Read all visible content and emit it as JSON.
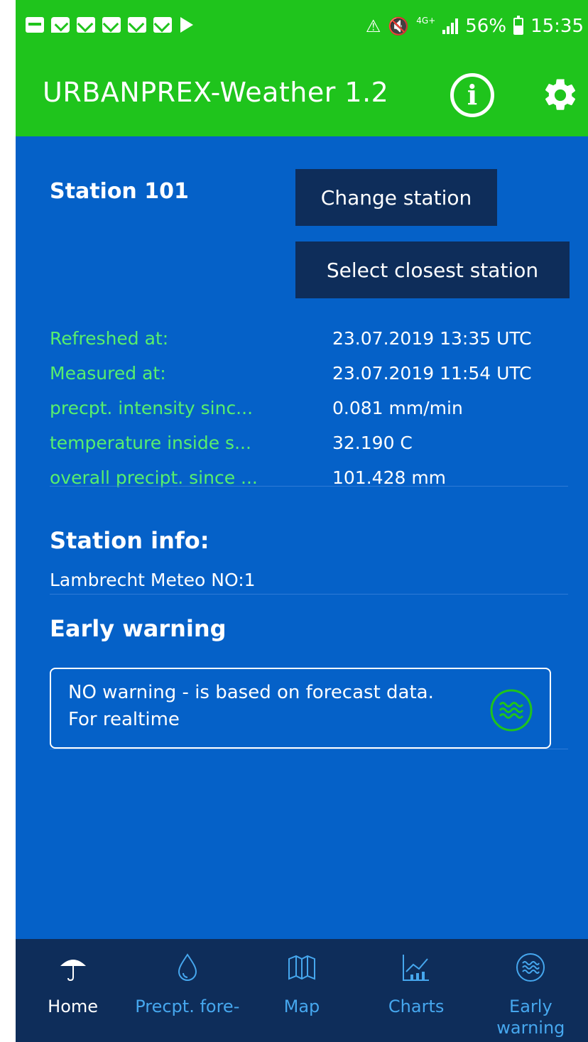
{
  "status_bar": {
    "network": "4G+",
    "battery": "56%",
    "time": "15:35",
    "battery_level": 0.56
  },
  "app_bar": {
    "title": "URBANPREX-Weather 1.2"
  },
  "station": {
    "title": "Station 101",
    "change_label": "Change station",
    "closest_label": "Select closest station"
  },
  "measurements": [
    {
      "label": "Refreshed at:",
      "value": "23.07.2019 13:35 UTC"
    },
    {
      "label": "Measured at:",
      "value": "23.07.2019 11:54 UTC"
    },
    {
      "label": "precpt. intensity sinc...",
      "value": "0.081 mm/min"
    },
    {
      "label": "temperature inside s...",
      "value": "32.190 C"
    },
    {
      "label": "overall precipt. since ...",
      "value": "101.428 mm"
    }
  ],
  "station_info": {
    "title": "Station info:",
    "text": "Lambrecht Meteo NO:1"
  },
  "early_warning": {
    "title": "Early warning",
    "text": "NO warning - is based on forecast data. For realtime"
  },
  "bottom_nav": [
    {
      "label": "Home",
      "icon": "umbrella-icon",
      "active": true
    },
    {
      "label": "Precpt. fore-",
      "icon": "drop-icon",
      "active": false
    },
    {
      "label": "Map",
      "icon": "map-icon",
      "active": false
    },
    {
      "label": "Charts",
      "icon": "chart-icon",
      "active": false
    },
    {
      "label": "Early warning",
      "icon": "waves-icon",
      "active": false
    }
  ],
  "colors": {
    "green": "#1fc41c",
    "blue": "#0561c8",
    "navy": "#0e2d5a",
    "label_green": "#58ef6c",
    "nav_blue": "#46a7ee"
  }
}
